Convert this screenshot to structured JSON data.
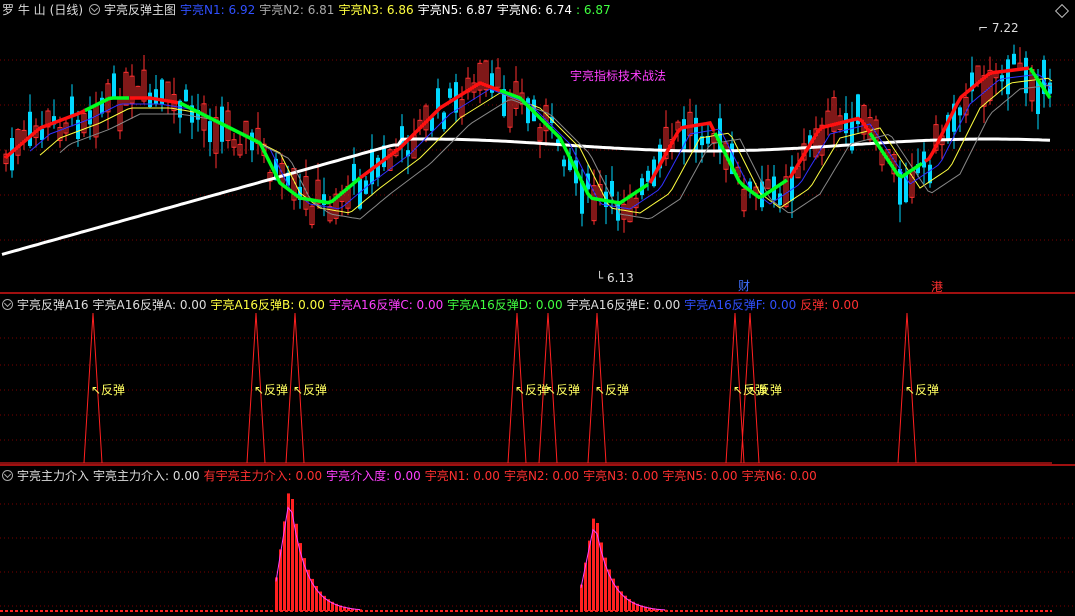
{
  "colors": {
    "up": "#ff3030",
    "down": "#00d8ff",
    "ma_red": "#ff1010",
    "ma_green": "#00ff20",
    "white": "#ffffff",
    "yellow": "#ffff40",
    "magenta": "#ff40ff",
    "blue": "#3030ff",
    "spike": "#ff2020",
    "grid": "#7a0000"
  },
  "main": {
    "stock_name": "罗 牛 山",
    "period": "(日线)",
    "indicator": "宇亮反弹主图",
    "legend": [
      {
        "label": "宇亮N1: 6.92",
        "color": "#3050ff"
      },
      {
        "label": "宇亮N2: 6.81",
        "color": "#aaaaaa"
      },
      {
        "label": "宇亮N3: 6.86",
        "color": "#ffff40"
      },
      {
        "label": "宇亮N5: 6.87",
        "color": "#ffffff"
      },
      {
        "label": "宇亮N6: 6.74",
        "color": "#ffffff"
      },
      {
        "label": ": 6.87",
        "color": "#40ff40"
      }
    ],
    "watermark": "宇亮指标技术战法",
    "high_label": "7.22",
    "low_label": "6.13",
    "tag_cai": "财",
    "tag_gang": "港"
  },
  "sub1": {
    "title": "宇亮反弹A16",
    "legend": [
      {
        "label": "宇亮A16反弹A: 0.00",
        "color": "#dddddd"
      },
      {
        "label": "宇亮A16反弹B: 0.00",
        "color": "#ffff40"
      },
      {
        "label": "宇亮A16反弹C: 0.00",
        "color": "#ff40ff"
      },
      {
        "label": "宇亮A16反弹D: 0.00",
        "color": "#40ff40"
      },
      {
        "label": "宇亮A16反弹E: 0.00",
        "color": "#dddddd"
      },
      {
        "label": "宇亮A16反弹F: 0.00",
        "color": "#3050ff"
      },
      {
        "label": "反弹: 0.00",
        "color": "#ff3030"
      }
    ],
    "signal_label": "反弹"
  },
  "sub2": {
    "title": "宇亮主力介入",
    "legend": [
      {
        "label": "宇亮主力介入: 0.00",
        "color": "#dddddd"
      },
      {
        "label": "有宇亮主力介入: 0.00",
        "color": "#ff3030"
      },
      {
        "label": "宇亮介入度: 0.00",
        "color": "#ff40ff"
      },
      {
        "label": "宇亮N1: 0.00",
        "color": "#ff3030"
      },
      {
        "label": "宇亮N2: 0.00",
        "color": "#ff3030"
      },
      {
        "label": "宇亮N3: 0.00",
        "color": "#ff3030"
      },
      {
        "label": "宇亮N5: 0.00",
        "color": "#ff3030"
      },
      {
        "label": "宇亮N6: 0.00",
        "color": "#ff3030"
      }
    ]
  }
}
